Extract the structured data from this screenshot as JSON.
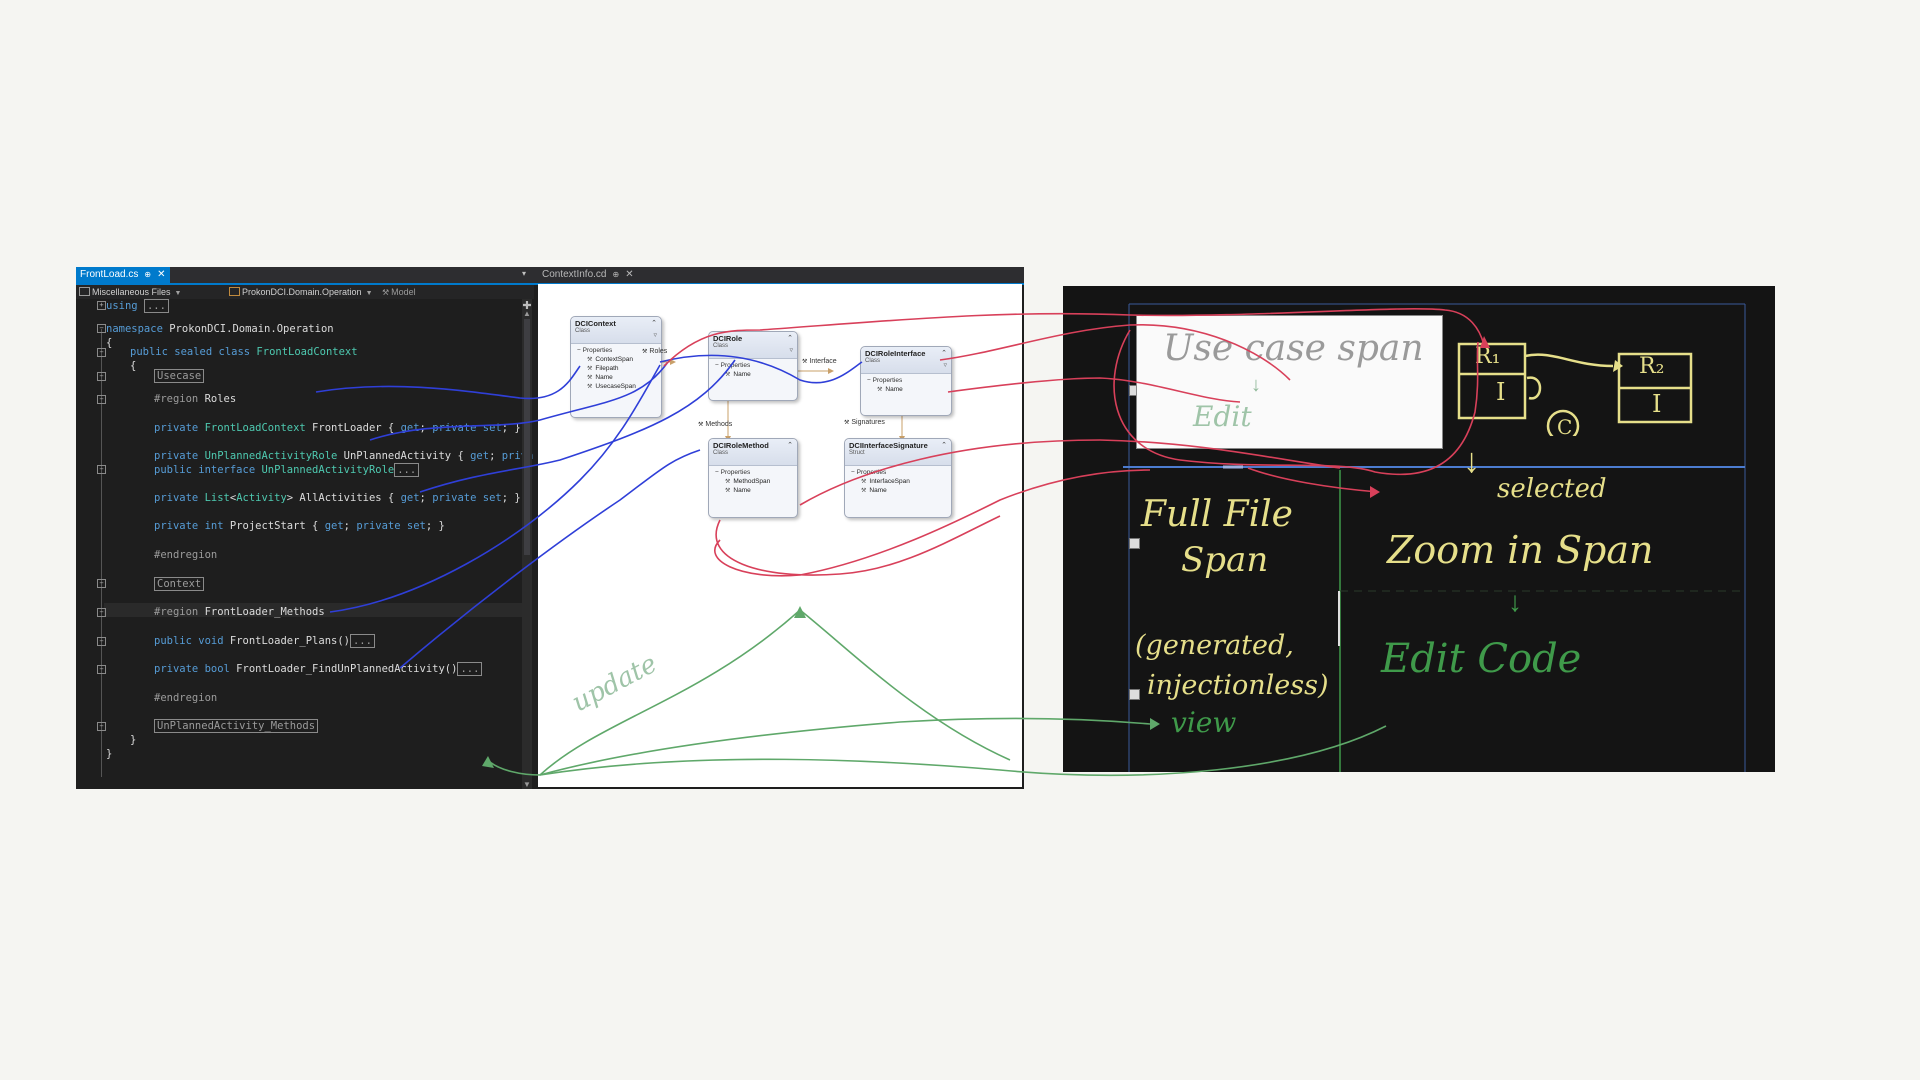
{
  "ide": {
    "tabs": [
      {
        "label": "FrontLoad.cs",
        "pin": "⊕",
        "close": "✕"
      },
      {
        "label": "ContextInfo.cd",
        "pin": "⊕",
        "close": "✕"
      }
    ],
    "tab_dropdown": "▾",
    "navbar": {
      "files": "Miscellaneous Files",
      "namespace": "ProkonDCI.Domain.Operation",
      "member": "Model"
    },
    "code": {
      "using_kw": "using",
      "using_box": "...",
      "ns_kw": "namespace",
      "ns_name": " ProkonDCI.Domain.Operation",
      "brace_open": "{",
      "class_decl_kw": "public sealed class",
      "class_name": " FrontLoadContext",
      "class_brace": "{",
      "usecase_box": "Usecase",
      "region_kw": "#region",
      "region_roles": " Roles",
      "p1_kw": "private",
      "p1_type": " FrontLoadContext",
      "p1_rest": " FrontLoader { ",
      "p1_get": "get",
      "p1_sep": "; ",
      "p1_priv": "private",
      "p1_set": " set",
      "p1_end": "; }",
      "p2_kw": "private",
      "p2_type": " UnPlannedActivityRole",
      "p2_rest": " UnPlannedActivity { ",
      "p2_get": "get",
      "p2_sep": "; ",
      "p2_priv": "priva",
      "p3_kw": "public interface",
      "p3_type": " UnPlannedActivityRole",
      "p3_box": "...",
      "p4_kw": "private",
      "p4_type": " List",
      "p4_lt": "<",
      "p4_gen": "Activity",
      "p4_gt": ">",
      "p4_rest": " AllActivities { ",
      "p4_get": "get",
      "p4_sep": "; ",
      "p4_priv": "private",
      "p4_set": " set",
      "p4_end": "; }",
      "p5_kw": "private int",
      "p5_rest": " ProjectStart { ",
      "p5_get": "get",
      "p5_sep": "; ",
      "p5_priv": "private",
      "p5_set": " set",
      "p5_end": "; }",
      "endregion1": "#endregion",
      "context_box": "Context",
      "region2_kw": "#region",
      "region2_name": " FrontLoader_Methods",
      "m1_kw": "public void",
      "m1_name": " FrontLoader_Plans()",
      "m1_box": "...",
      "m2_kw": "private bool",
      "m2_name": " FrontLoader_FindUnPlannedActivity()",
      "m2_box": "...",
      "endregion2": "#endregion",
      "unplanned_box": "UnPlannedActivity_Methods",
      "close1": "}",
      "close2": "}"
    },
    "diagram": {
      "classes": {
        "context": {
          "name": "DCIContext",
          "kind": "Class",
          "section": "Properties",
          "members": [
            "ContextSpan",
            "Filepath",
            "Name",
            "UsecaseSpan"
          ]
        },
        "role": {
          "name": "DCIRole",
          "kind": "Class",
          "section": "Properties",
          "members": [
            "Name"
          ]
        },
        "role_interface": {
          "name": "DCIRoleInterface",
          "kind": "Class",
          "section": "Properties",
          "members": [
            "Name"
          ]
        },
        "role_method": {
          "name": "DCIRoleMethod",
          "kind": "Class",
          "section": "Properties",
          "members": [
            "MethodSpan",
            "Name"
          ]
        },
        "interface_signature": {
          "name": "DCIInterfaceSignature",
          "kind": "Struct",
          "section": "Properties",
          "members": [
            "InterfaceSpan",
            "Name"
          ]
        }
      },
      "associations": {
        "roles": "Roles",
        "interface": "Interface",
        "methods": "Methods",
        "signatures": "Signatures"
      }
    }
  },
  "sketch": {
    "use_case_span": "Use case span",
    "edit_top": "Edit",
    "full_file_line1": "Full File",
    "full_file_line2": "Span",
    "zoom_in_span": "Zoom in Span",
    "selected": "selected",
    "edit_code": "Edit Code",
    "generated_line1": "(generated,",
    "generated_line2": "injectionless)",
    "view": "view",
    "box_r1": "R₁",
    "box_r2": "R₂",
    "box_i": "I",
    "circle_c": "C"
  },
  "annotations": {
    "update": "update"
  },
  "colors": {
    "ink_blue": "#2f3fd8",
    "ink_red": "#d8405a",
    "ink_green": "#5fa86a",
    "ink_yellow": "#e6df8a",
    "sketch_green": "#3f9a4a",
    "accent": "#007acc"
  }
}
